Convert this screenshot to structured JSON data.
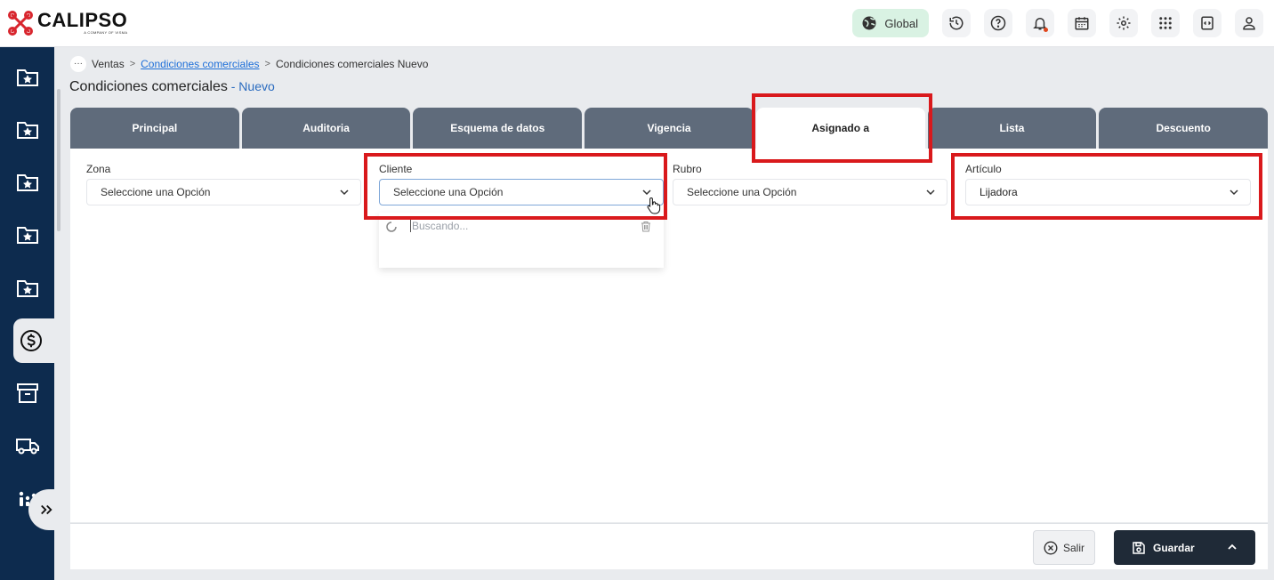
{
  "app": {
    "brand_name": "CALIPSO",
    "brand_tagline": "A COMPANY OF VISMA"
  },
  "topbar": {
    "global_label": "Global",
    "icons": [
      "globe-icon",
      "history-icon",
      "help-icon",
      "bell-icon",
      "calendar-icon",
      "settings-icon",
      "apps-grid-icon",
      "code-window-icon",
      "user-icon"
    ]
  },
  "sidebar": {
    "items": [
      {
        "icon": "folder-star-icon"
      },
      {
        "icon": "folder-star-icon"
      },
      {
        "icon": "folder-star-icon"
      },
      {
        "icon": "folder-star-icon"
      },
      {
        "icon": "folder-star-icon"
      },
      {
        "icon": "dollar-circle-icon",
        "active": true
      },
      {
        "icon": "archive-icon"
      },
      {
        "icon": "truck-icon"
      },
      {
        "icon": "chart-dots-icon"
      }
    ],
    "expand_icon": "double-chevron-right-icon"
  },
  "breadcrumb": {
    "more": "···",
    "items": [
      "Ventas",
      "Condiciones comerciales",
      "Condiciones comerciales Nuevo"
    ],
    "separator": ">"
  },
  "page": {
    "title": "Condiciones comerciales",
    "subtitle": " - Nuevo"
  },
  "tabs": [
    {
      "label": "Principal"
    },
    {
      "label": "Auditoria"
    },
    {
      "label": "Esquema de datos"
    },
    {
      "label": "Vigencia"
    },
    {
      "label": "Asignado a",
      "active": true
    },
    {
      "label": "Lista"
    },
    {
      "label": "Descuento"
    }
  ],
  "form": {
    "zona": {
      "label": "Zona",
      "value": "Seleccione una Opción"
    },
    "cliente": {
      "label": "Cliente",
      "value": "Seleccione una Opción"
    },
    "rubro": {
      "label": "Rubro",
      "value": "Seleccione una Opción"
    },
    "articulo": {
      "label": "Artículo",
      "value": "Lijadora"
    }
  },
  "dropdown": {
    "search_placeholder": "Buscando..."
  },
  "footer": {
    "exit_label": "Salir",
    "save_label": "Guardar"
  },
  "colors": {
    "sidebar_bg": "#0d2b4e",
    "tab_bg": "#5f6b7b",
    "highlight": "#d9191c",
    "save_bg": "#1f2a37",
    "global_bg": "#d9f2e3"
  }
}
